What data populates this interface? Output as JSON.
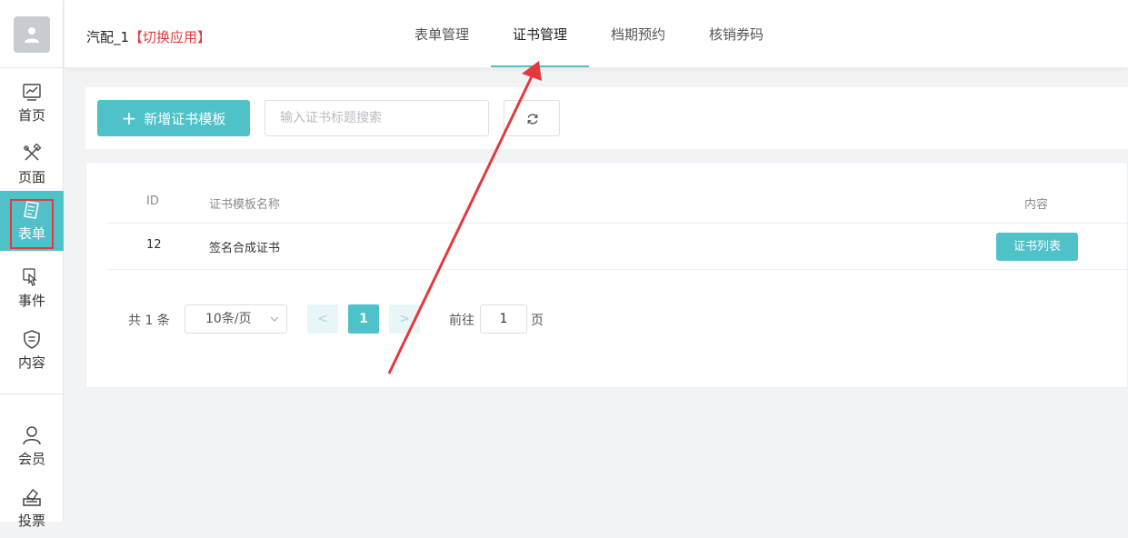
{
  "sidebar": {
    "items": [
      {
        "label": "首页",
        "icon": "chart-icon"
      },
      {
        "label": "页面",
        "icon": "edit-tools-icon"
      },
      {
        "label": "表单",
        "icon": "form-doc-icon"
      },
      {
        "label": "事件",
        "icon": "hand-pointer-icon"
      },
      {
        "label": "内容",
        "icon": "shield-doc-icon"
      },
      {
        "label": "会员",
        "icon": "user-icon"
      },
      {
        "label": "投票",
        "icon": "vote-box-icon"
      }
    ]
  },
  "header": {
    "app_name": "汽配_1",
    "switch_label": "【切换应用】",
    "tabs": [
      {
        "label": "表单管理"
      },
      {
        "label": "证书管理"
      },
      {
        "label": "档期预约"
      },
      {
        "label": "核销券码"
      }
    ]
  },
  "toolbar": {
    "add_label": "新增证书模板",
    "search_placeholder": "输入证书标题搜索"
  },
  "table": {
    "headers": [
      "ID",
      "证书模板名称",
      "内容"
    ],
    "rows": [
      {
        "id": "12",
        "name": "签名合成证书",
        "action": "证书列表"
      }
    ]
  },
  "pagination": {
    "total": "共 1 条",
    "page_size": "10条/页",
    "prev": "<",
    "current": "1",
    "next": ">",
    "goto_label": "前往",
    "goto_value": "1",
    "page_unit": "页"
  },
  "colors": {
    "accent": "#4fc1c9",
    "highlight": "#e4393c"
  }
}
